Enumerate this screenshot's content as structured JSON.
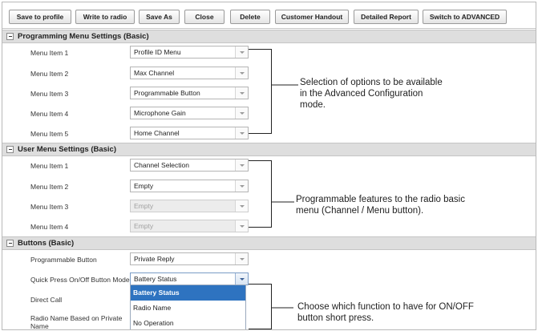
{
  "toolbar": {
    "buttons": [
      "Save to profile",
      "Write to radio",
      "Save As",
      "Close",
      "Delete",
      "Customer Handout",
      "Detailed Report",
      "Switch to ADVANCED"
    ]
  },
  "programming_menu": {
    "title": "Programming Menu Settings (Basic)",
    "rows": [
      {
        "label": "Menu Item 1",
        "value": "Profile ID Menu"
      },
      {
        "label": "Menu Item 2",
        "value": "Max Channel"
      },
      {
        "label": "Menu Item 3",
        "value": "Programmable Button"
      },
      {
        "label": "Menu Item 4",
        "value": "Microphone Gain"
      },
      {
        "label": "Menu Item 5",
        "value": "Home Channel"
      }
    ]
  },
  "user_menu": {
    "title": "User Menu Settings (Basic)",
    "rows": [
      {
        "label": "Menu Item 1",
        "value": "Channel Selection",
        "disabled": false
      },
      {
        "label": "Menu Item 2",
        "value": "Empty",
        "disabled": false
      },
      {
        "label": "Menu Item 3",
        "value": "Empty",
        "disabled": true
      },
      {
        "label": "Menu Item 4",
        "value": "Empty",
        "disabled": true
      }
    ]
  },
  "buttons_section": {
    "title": "Buttons (Basic)",
    "rows": [
      {
        "label": "Programmable Button",
        "value": "Private Reply"
      },
      {
        "label": "Quick Press On/Off Button Mode",
        "value": "Battery Status"
      },
      {
        "label": "Direct Call"
      },
      {
        "label": "Radio Name Based on Private Name"
      }
    ],
    "dropdown_options": [
      "Battery Status",
      "Radio Name",
      "No Operation"
    ],
    "dropdown_selected": "Battery Status"
  },
  "annotations": {
    "programming": [
      "Selection of options to be available",
      "in the Advanced Configuration",
      "mode."
    ],
    "user": [
      "Programmable features to the radio basic",
      "menu (Channel / Menu button)."
    ],
    "buttons": [
      "Choose which function to have for ON/OFF",
      "button short press."
    ]
  },
  "colors": {
    "section_header_bg": "#dedede",
    "dropdown_selected_bg": "#2e73c0",
    "disabled_field_bg": "#ececec"
  },
  "icons": {
    "section_toggle": "collapse-minus-icon",
    "select_arrow": "chevron-down-icon"
  }
}
